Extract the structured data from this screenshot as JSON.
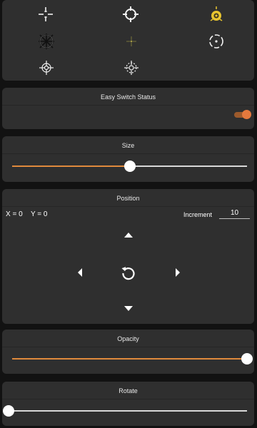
{
  "crosshairs": [
    {
      "icon": "crosshair-gap-cross-icon"
    },
    {
      "icon": "crosshair-circle-icon"
    },
    {
      "icon": "crosshair-yellow-dot-icon"
    },
    {
      "icon": "crosshair-scope-reticle-icon"
    },
    {
      "icon": "crosshair-dim-dot-icon"
    },
    {
      "icon": "crosshair-dashed-ring-icon"
    },
    {
      "icon": "crosshair-small-reticle-icon"
    },
    {
      "icon": "crosshair-dotted-reticle-icon"
    }
  ],
  "easy_switch": {
    "title": "Easy Switch Status",
    "enabled": true
  },
  "size": {
    "title": "Size",
    "value": 0.5
  },
  "position": {
    "title": "Position",
    "x_label": "X = 0",
    "y_label": "Y = 0",
    "increment_label": "Increment",
    "increment_value": "10",
    "icons": [
      "up-arrow-icon",
      "left-arrow-icon",
      "reset-icon",
      "right-arrow-icon",
      "down-arrow-icon"
    ]
  },
  "opacity": {
    "title": "Opacity",
    "value": 1.0
  },
  "rotate": {
    "title": "Rotate",
    "value": 0.0
  },
  "colors": {
    "card": "#2f2f2f",
    "background": "#121212",
    "accent": "#e08a3c",
    "toggle_track": "#9c5a2c",
    "toggle_thumb": "#e5793d",
    "crosshair_yellow": "#e8c530"
  }
}
